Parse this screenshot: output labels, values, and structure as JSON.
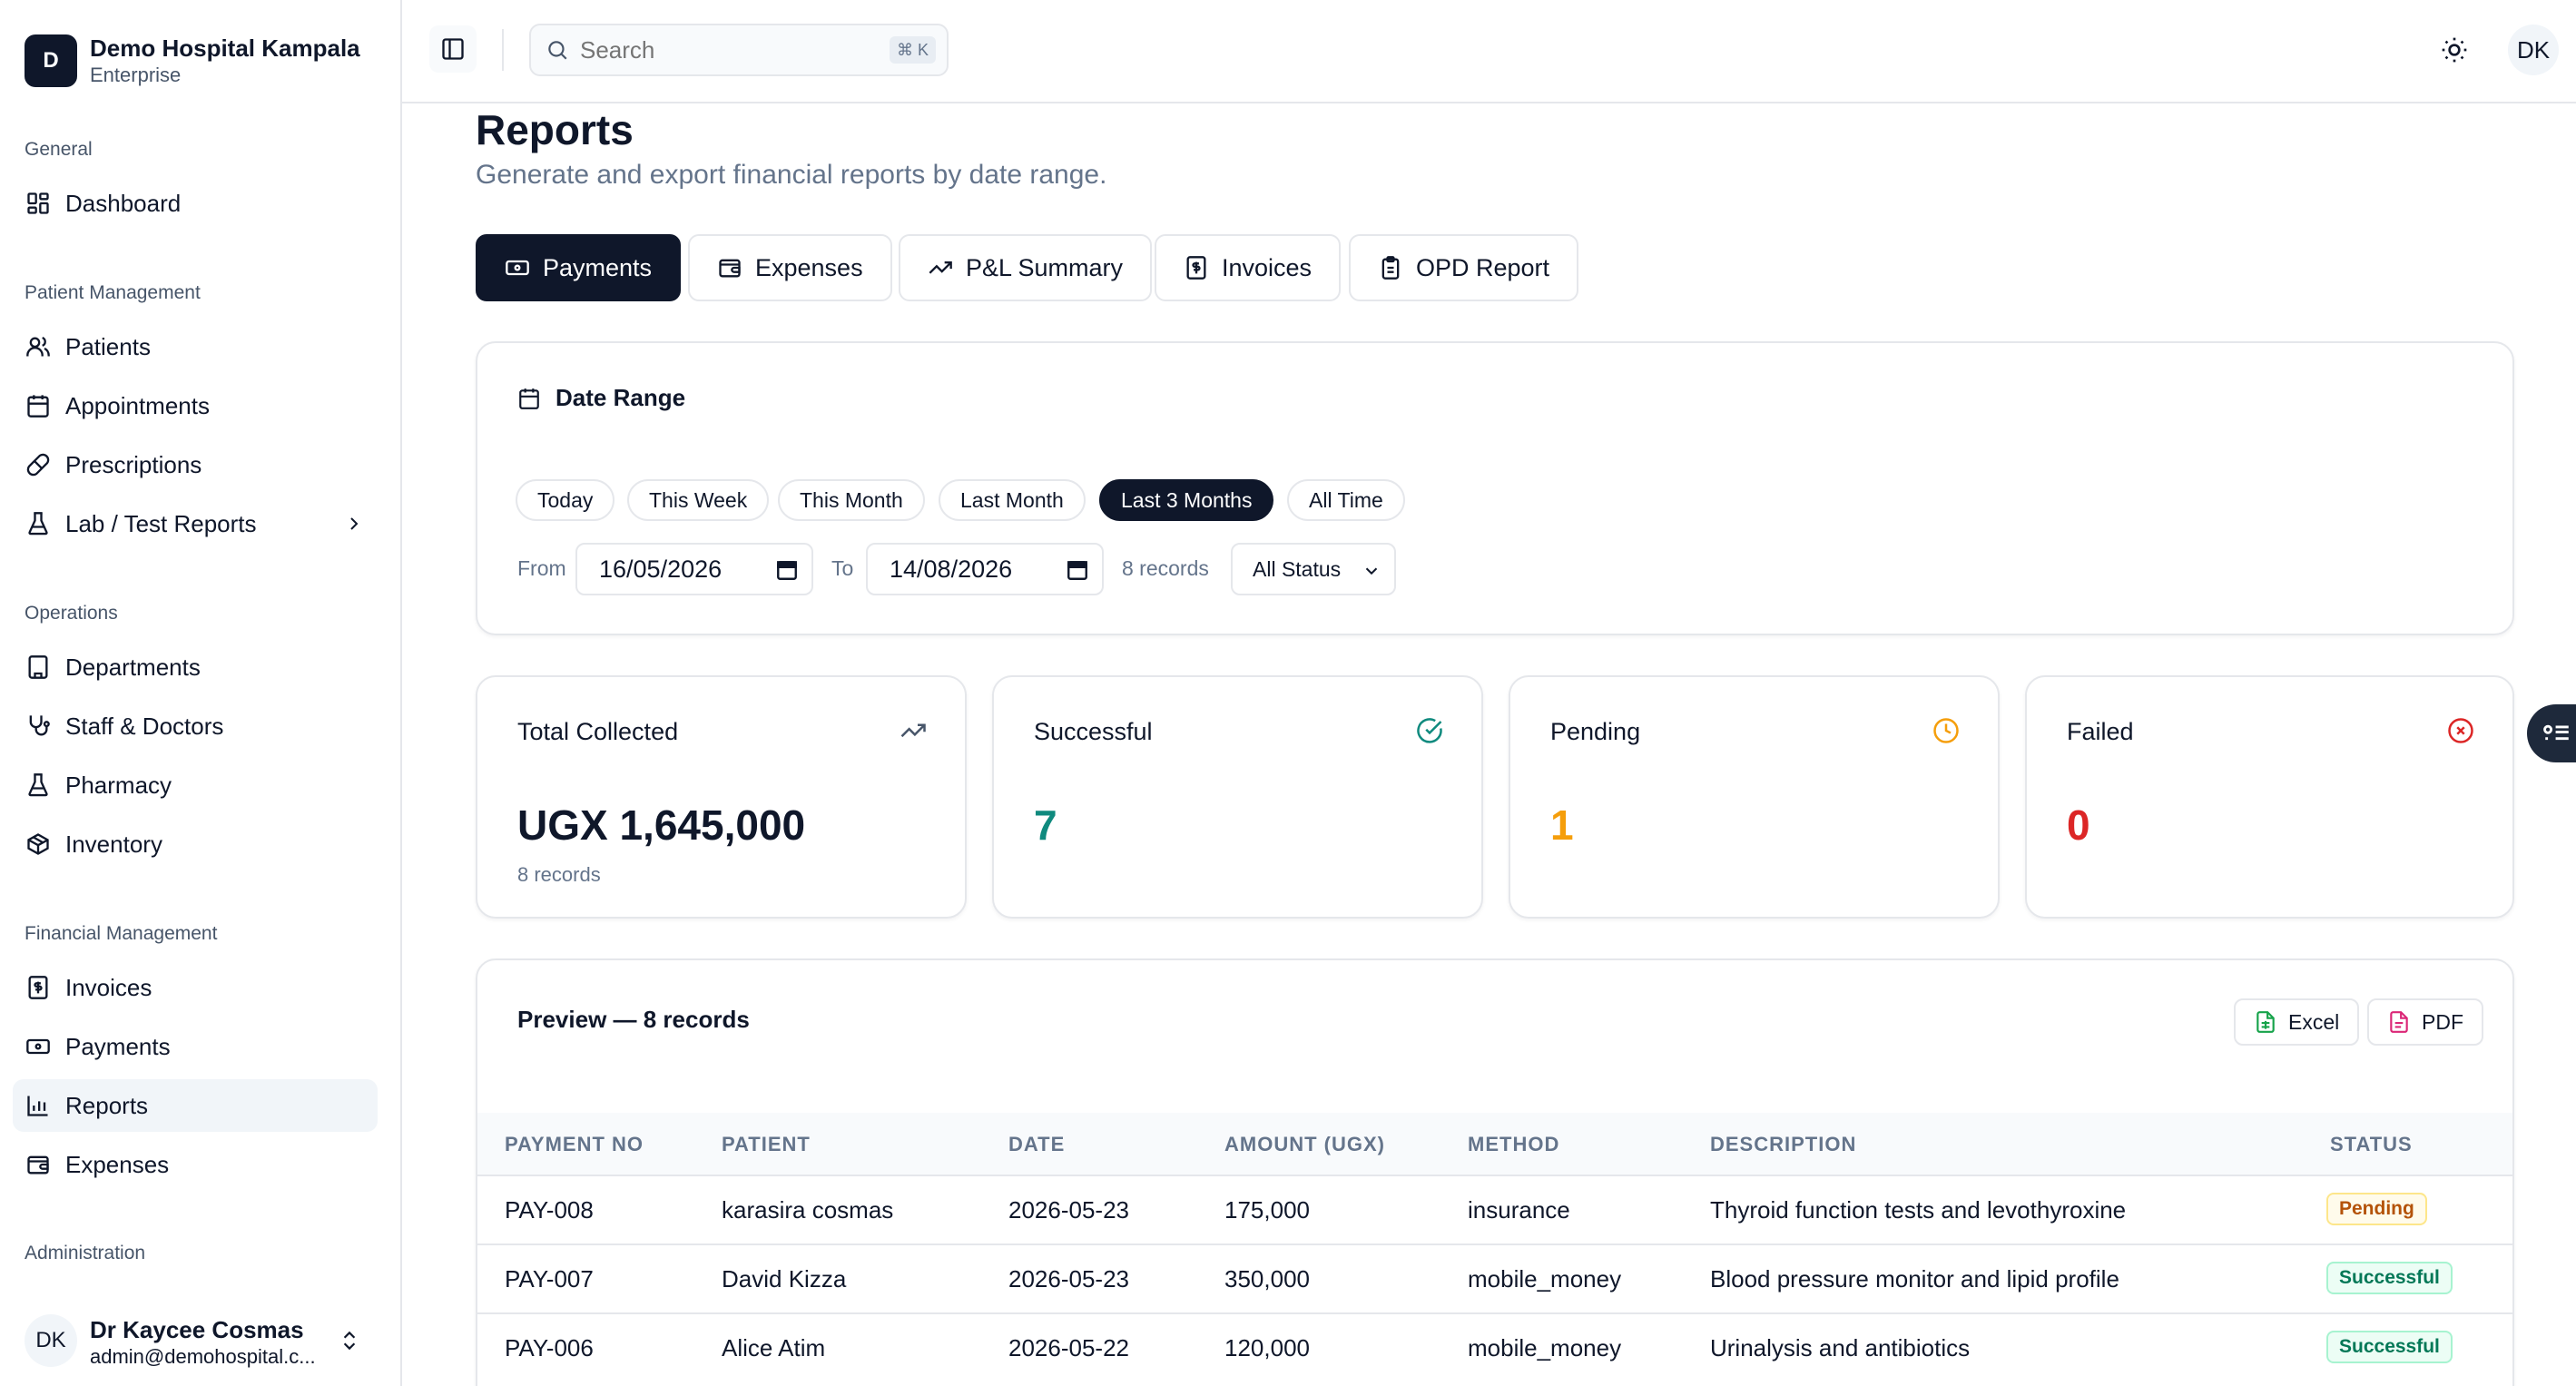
{
  "org": {
    "initial": "D",
    "name": "Demo Hospital Kampala",
    "plan": "Enterprise"
  },
  "sidebar": {
    "groups": [
      {
        "label": "General"
      },
      {
        "label": "Patient Management"
      },
      {
        "label": "Operations"
      },
      {
        "label": "Financial Management"
      },
      {
        "label": "Administration"
      }
    ],
    "items": [
      {
        "label": "Dashboard",
        "icon": "dashboard-icon"
      },
      {
        "label": "Patients",
        "icon": "users-icon"
      },
      {
        "label": "Appointments",
        "icon": "calendar-icon"
      },
      {
        "label": "Prescriptions",
        "icon": "pill-icon"
      },
      {
        "label": "Lab / Test Reports",
        "icon": "flask-icon"
      },
      {
        "label": "Departments",
        "icon": "building-icon"
      },
      {
        "label": "Staff & Doctors",
        "icon": "stethoscope-icon"
      },
      {
        "label": "Pharmacy",
        "icon": "flask-icon"
      },
      {
        "label": "Inventory",
        "icon": "package-icon"
      },
      {
        "label": "Invoices",
        "icon": "receipt-icon"
      },
      {
        "label": "Payments",
        "icon": "banknote-icon"
      },
      {
        "label": "Reports",
        "icon": "bar-chart-icon",
        "active": true
      },
      {
        "label": "Expenses",
        "icon": "wallet-icon"
      }
    ]
  },
  "user": {
    "initials": "DK",
    "name": "Dr Kaycee Cosmas",
    "email": "admin@demohospital.c..."
  },
  "topbar": {
    "search_placeholder": "Search",
    "shortcut": "⌘ K",
    "avatar_initials": "DK"
  },
  "page": {
    "title": "Reports",
    "subtitle": "Generate and export financial reports by date range."
  },
  "report_tabs": [
    {
      "label": "Payments",
      "active": true
    },
    {
      "label": "Expenses"
    },
    {
      "label": "P&L Summary"
    },
    {
      "label": "Invoices"
    },
    {
      "label": "OPD Report"
    }
  ],
  "date_range": {
    "title": "Date Range",
    "presets": [
      "Today",
      "This Week",
      "This Month",
      "Last Month",
      "Last 3 Months",
      "All Time"
    ],
    "active_preset": "Last 3 Months",
    "from_label": "From",
    "from_value": "16/05/2026",
    "to_label": "To",
    "to_value": "14/08/2026",
    "records": "8 records",
    "status_value": "All Status"
  },
  "stats": [
    {
      "title": "Total Collected",
      "value": "UGX 1,645,000",
      "sub": "8 records",
      "color": "#0f172a",
      "icon": "trending-up-icon"
    },
    {
      "title": "Successful",
      "value": "7",
      "color": "#0f8a7e",
      "icon": "check-circle-icon"
    },
    {
      "title": "Pending",
      "value": "1",
      "color": "#f59e0b",
      "icon": "clock-icon"
    },
    {
      "title": "Failed",
      "value": "0",
      "color": "#dc2626",
      "icon": "x-circle-icon"
    }
  ],
  "preview": {
    "title": "Preview — 8 records",
    "excel_label": "Excel",
    "pdf_label": "PDF",
    "columns": [
      "PAYMENT NO",
      "PATIENT",
      "DATE",
      "AMOUNT (UGX)",
      "METHOD",
      "DESCRIPTION",
      "STATUS"
    ],
    "rows": [
      {
        "no": "PAY-008",
        "patient": "karasira cosmas",
        "date": "2026-05-23",
        "amount": "175,000",
        "method": "insurance",
        "description": "Thyroid function tests and levothyroxine",
        "status": "Pending"
      },
      {
        "no": "PAY-007",
        "patient": "David Kizza",
        "date": "2026-05-23",
        "amount": "350,000",
        "method": "mobile_money",
        "description": "Blood pressure monitor and lipid profile",
        "status": "Successful"
      },
      {
        "no": "PAY-006",
        "patient": "Alice Atim",
        "date": "2026-05-22",
        "amount": "120,000",
        "method": "mobile_money",
        "description": "Urinalysis and antibiotics",
        "status": "Successful"
      }
    ]
  }
}
